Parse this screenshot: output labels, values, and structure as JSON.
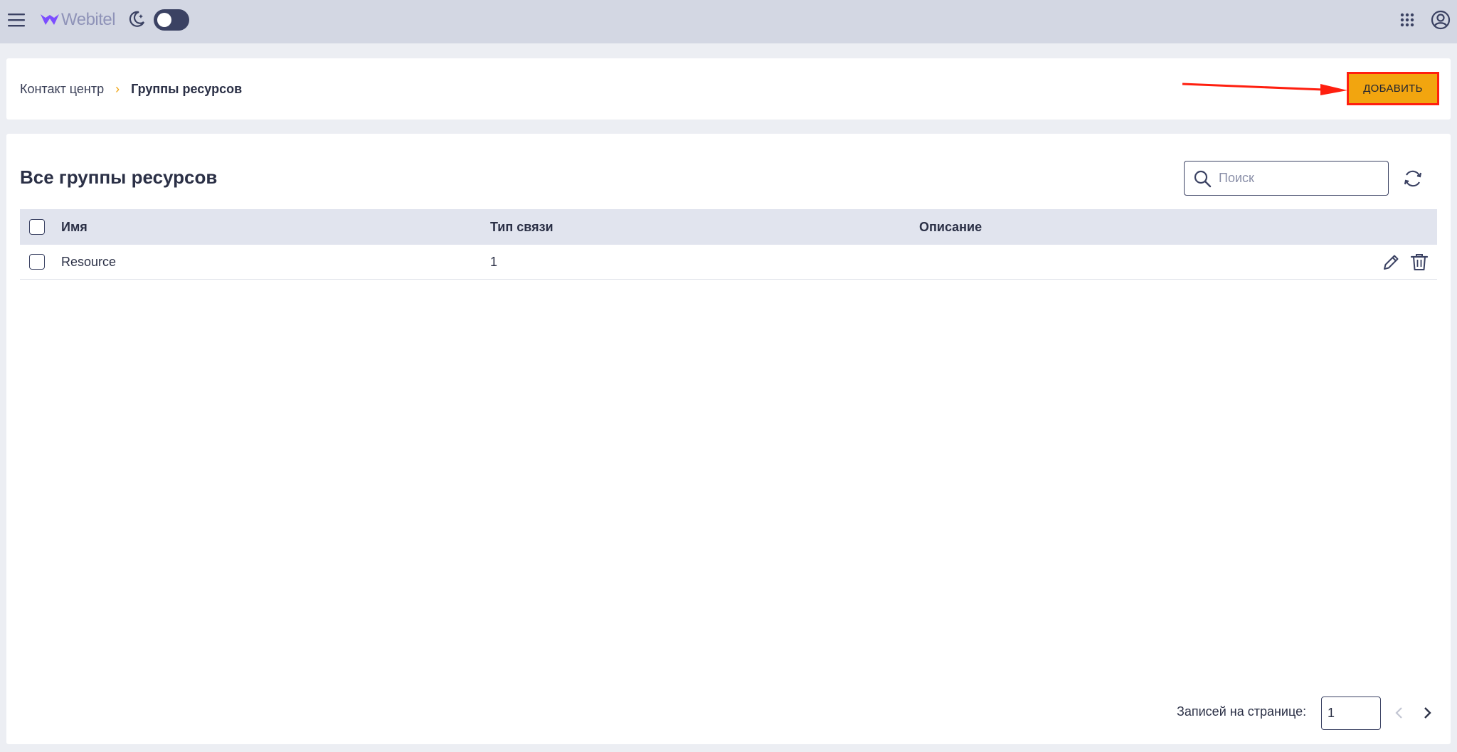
{
  "header": {
    "logo_text": "Webitel",
    "theme_toggle_on": false
  },
  "breadcrumb": {
    "parent": "Контакт центр",
    "separator": "›",
    "current": "Группы ресурсов"
  },
  "toolbar": {
    "add_label": "ДОБАВИТЬ"
  },
  "main": {
    "title": "Все группы ресурсов",
    "search_placeholder": "Поиск"
  },
  "table": {
    "columns": [
      "Имя",
      "Тип связи",
      "Описание"
    ],
    "rows": [
      {
        "name": "Resource",
        "type": "1",
        "description": ""
      }
    ]
  },
  "pagination": {
    "label": "Записей на странице:",
    "page_size": "1"
  },
  "colors": {
    "accent": "#f2a50f",
    "highlight_annotation": "#ff1f0f",
    "topbar": "#d3d7e3",
    "table_header": "#e1e4ee"
  }
}
